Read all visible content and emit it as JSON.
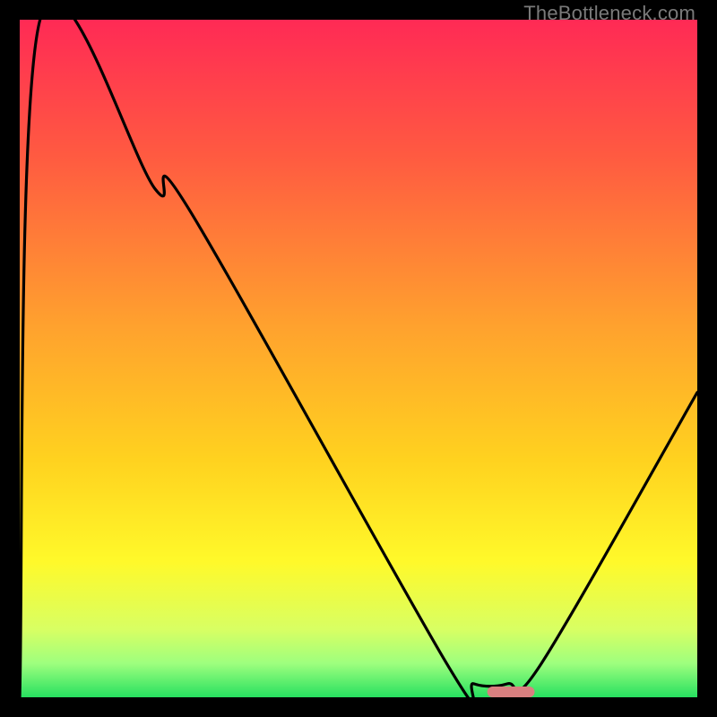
{
  "watermark": "TheBottleneck.com",
  "chart_data": {
    "type": "line",
    "title": "",
    "xlabel": "",
    "ylabel": "",
    "xlim": [
      0,
      100
    ],
    "ylim": [
      0,
      100
    ],
    "x": [
      0,
      3,
      20,
      25,
      63,
      67,
      72,
      77,
      100
    ],
    "y": [
      0,
      100,
      75,
      72,
      5,
      2,
      2,
      5,
      45
    ],
    "minimum_marker": {
      "x_start": 69,
      "x_end": 76,
      "color": "#d98080"
    },
    "gradient_stops": [
      {
        "offset": 0.0,
        "color": "#ff2a55"
      },
      {
        "offset": 0.2,
        "color": "#ff5a41"
      },
      {
        "offset": 0.45,
        "color": "#ffa12e"
      },
      {
        "offset": 0.65,
        "color": "#ffd21f"
      },
      {
        "offset": 0.8,
        "color": "#fff92a"
      },
      {
        "offset": 0.9,
        "color": "#d8ff63"
      },
      {
        "offset": 0.95,
        "color": "#9eff7e"
      },
      {
        "offset": 1.0,
        "color": "#27e060"
      }
    ]
  }
}
